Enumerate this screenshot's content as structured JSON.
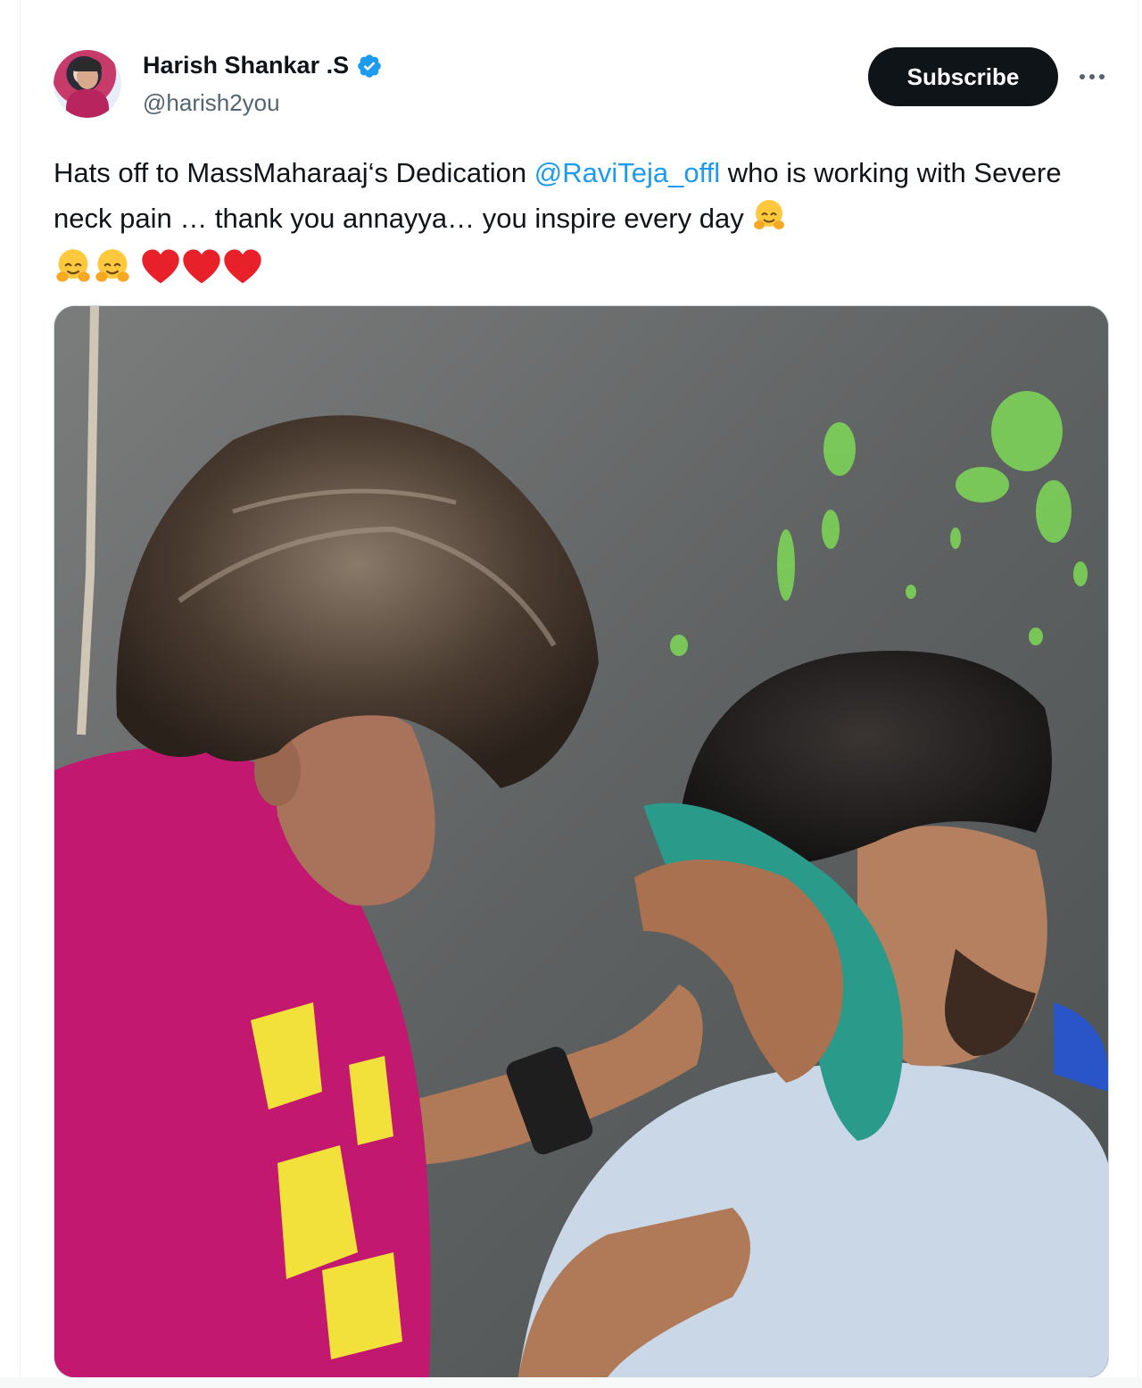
{
  "author": {
    "display_name": "Harish Shankar .S",
    "handle": "@harish2you",
    "verified": true,
    "verified_badge_color": "#1d9bf0"
  },
  "actions": {
    "subscribe_label": "Subscribe",
    "more_icon": "more-horizontal-icon"
  },
  "tweet": {
    "text_part1": "Hats off to MassMaharaaj‘s Dedication ",
    "mention": "@RaviTeja_offl",
    "text_part2": " who is working with Severe neck pain … thank you annayya… you inspire every day ",
    "emojis": [
      "hugging-face",
      "hugging-face",
      "hugging-face",
      "red-heart",
      "red-heart",
      "red-heart"
    ],
    "mention_color": "#1d9bf0"
  },
  "media": {
    "type": "photo",
    "icon": "photo"
  }
}
